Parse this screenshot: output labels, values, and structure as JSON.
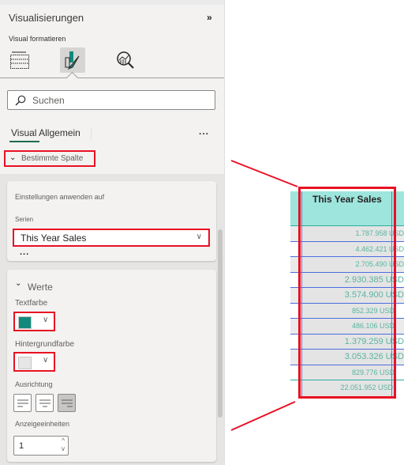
{
  "panel": {
    "title": "Visualisierungen",
    "collapse_icon": "double-chevron-right",
    "subtitle": "Visual formatieren",
    "tool_icons": [
      "build-visual-icon",
      "format-visual-icon",
      "analytics-icon"
    ],
    "search": {
      "placeholder": "Suchen",
      "value": ""
    },
    "tab": "Visual Allgemein",
    "more": "...",
    "section": "Bestimmte Spalte",
    "apply_settings": {
      "heading": "Einstellungen anwenden auf",
      "series_label": "Serien",
      "series_value": "This Year Sales",
      "more": "..."
    },
    "values": {
      "heading": "Werte",
      "text_color_label": "Textfarbe",
      "text_color": "#118a7c",
      "bg_color_label": "Hintergrundfarbe",
      "bg_color": "#e6e6e6",
      "alignment_label": "Ausrichtung",
      "alignment_options": [
        "left",
        "center",
        "right"
      ],
      "alignment_selected": "right",
      "display_units_label": "Anzeigeeinheiten",
      "display_units_value": "1"
    }
  },
  "table": {
    "header": "This Year Sales",
    "rows": [
      "1.787.958 USD",
      "4.462.421 USD",
      "2.705.490 USD",
      "2.930.385 USD",
      "3.574.900 USD",
      "852.329 USD",
      "486.106 USD",
      "1.379.259 USD",
      "3.053.326 USD",
      "829.776 USD"
    ],
    "total": "22.051.952 USD"
  },
  "colors": {
    "accent_red": "#e81123",
    "header_bg": "#9ee5dd",
    "value_text": "#5ab3a0"
  }
}
